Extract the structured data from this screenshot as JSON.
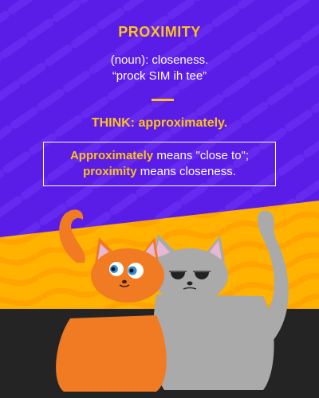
{
  "word": "PROXIMITY",
  "definition": {
    "line1": "(noun): closeness.",
    "line2": "“prock SIM ih tee”"
  },
  "think": "THINK: approximately.",
  "callout": {
    "hl1": "Approximately",
    "text1": " means \"close to\";",
    "hl2": "proximity",
    "text2": " means closeness."
  },
  "colors": {
    "purple": "#5A1DE8",
    "yellow": "#FFC21A",
    "orange_stripe": "#FFAE00",
    "dark_floor": "#242424",
    "orange_cat": "#F07B22",
    "gray_cat": "#AAAAAA"
  },
  "icons": [
    "orange-cat-illustration",
    "gray-cat-illustration"
  ]
}
